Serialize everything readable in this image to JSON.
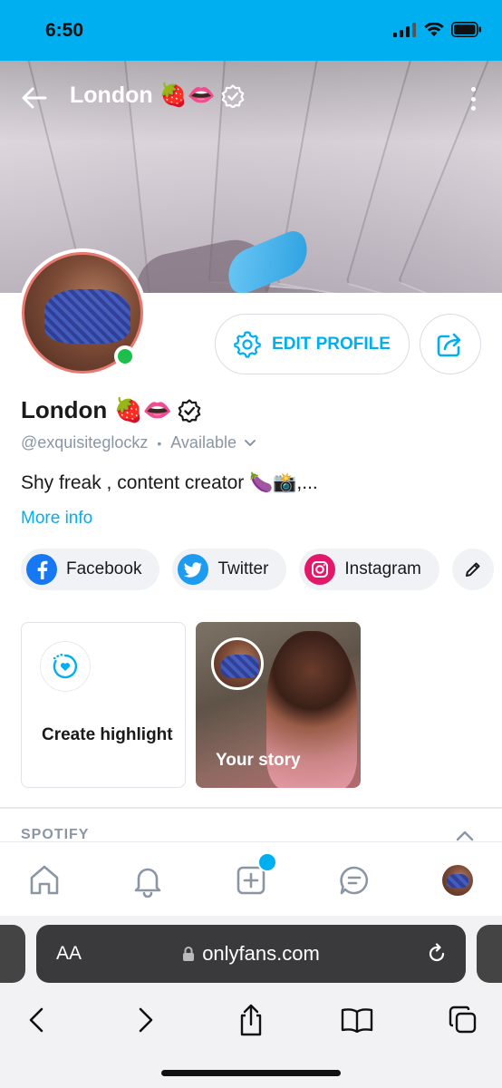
{
  "status": {
    "time": "6:50"
  },
  "header": {
    "title": "London 🍓👄",
    "title_badge": "verified-icon"
  },
  "profile": {
    "name": "London 🍓👄",
    "handle": "@exquisiteglockz",
    "separator": "•",
    "availability": "Available",
    "bio": "Shy freak , content creator 🍆📸,...",
    "more_info": "More info",
    "edit_label": "EDIT PROFILE"
  },
  "socials": [
    {
      "label": "Facebook",
      "color": "#1877f2"
    },
    {
      "label": "Twitter",
      "color": "#1d9bf0"
    },
    {
      "label": "Instagram",
      "color": "#e4186b"
    }
  ],
  "highlights": {
    "create_label": "Create highlight",
    "story_label": "Your story"
  },
  "sections": {
    "spotify": "SPOTIFY"
  },
  "browser": {
    "text_size": "AA",
    "url": "onlyfans.com"
  },
  "colors": {
    "accent": "#00aff0",
    "online": "#1bbf4a",
    "avatar_ring": "#e8776f"
  }
}
